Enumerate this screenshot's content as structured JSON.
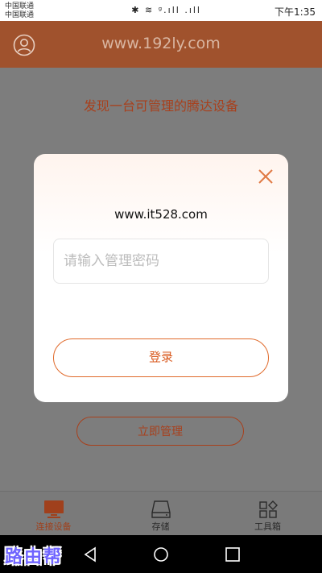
{
  "status_bar": {
    "carrier_1": "中国联通",
    "carrier_2": "中国联通",
    "right_text": "下午1:35",
    "icons": "✱ ≋ ᵍ.ıll .ıll"
  },
  "header": {
    "title": "www.192ly.com"
  },
  "main": {
    "found_text": "发现一台可管理的腾达设备",
    "manage_button": "立即管理"
  },
  "dialog": {
    "site_text": "www.it528.com",
    "password_placeholder": "请输入管理密码",
    "password_value": "",
    "login_button": "登录"
  },
  "bottom_nav": {
    "items": [
      {
        "label": "连接设备",
        "icon": "monitor-icon",
        "active": true
      },
      {
        "label": "存储",
        "icon": "storage-icon",
        "active": false
      },
      {
        "label": "工具箱",
        "icon": "toolbox-icon",
        "active": false
      }
    ]
  },
  "watermark": "路由帮",
  "colors": {
    "accent": "#a0522d",
    "login_border": "#e06a2b",
    "active_nav": "#a0401c"
  }
}
